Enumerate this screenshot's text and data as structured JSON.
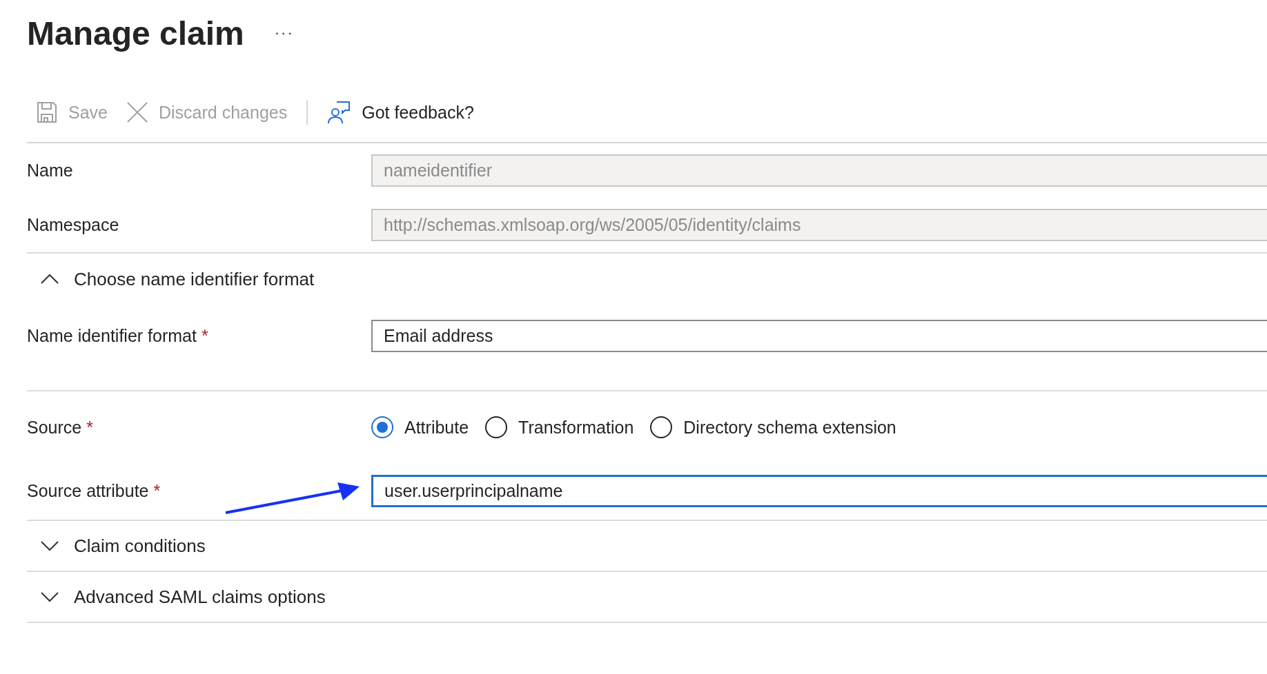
{
  "title": "Manage claim",
  "more": "···",
  "toolbar": [
    {
      "kind": "save",
      "label": "Save",
      "disabled": true
    },
    {
      "kind": "discard",
      "label": "Discard changes",
      "disabled": true
    },
    {
      "kind": "feedback",
      "label": "Got feedback?",
      "disabled": false
    }
  ],
  "fields_top": [
    {
      "label": "Name",
      "value": "nameidentifier",
      "disabled": true
    },
    {
      "label": "Namespace",
      "value": "http://schemas.xmlsoap.org/ws/2005/05/identity/claims",
      "disabled": true
    }
  ],
  "format_section": {
    "title": "Choose name identifier format",
    "expanded": true,
    "field": {
      "label": "Name identifier format",
      "value": "Email address",
      "required_mark": "*"
    }
  },
  "source": {
    "label": "Source",
    "required_mark": "*",
    "options": [
      {
        "label": "Attribute",
        "selected": true
      },
      {
        "label": "Transformation",
        "selected": false
      },
      {
        "label": "Directory schema extension",
        "selected": false
      }
    ]
  },
  "source_attribute": {
    "label": "Source attribute",
    "value": "user.userprincipalname",
    "required_mark": "*",
    "focused": true
  },
  "sections": [
    {
      "title": "Claim conditions",
      "expanded": false
    },
    {
      "title": "Advanced SAML claims options",
      "expanded": false
    }
  ]
}
